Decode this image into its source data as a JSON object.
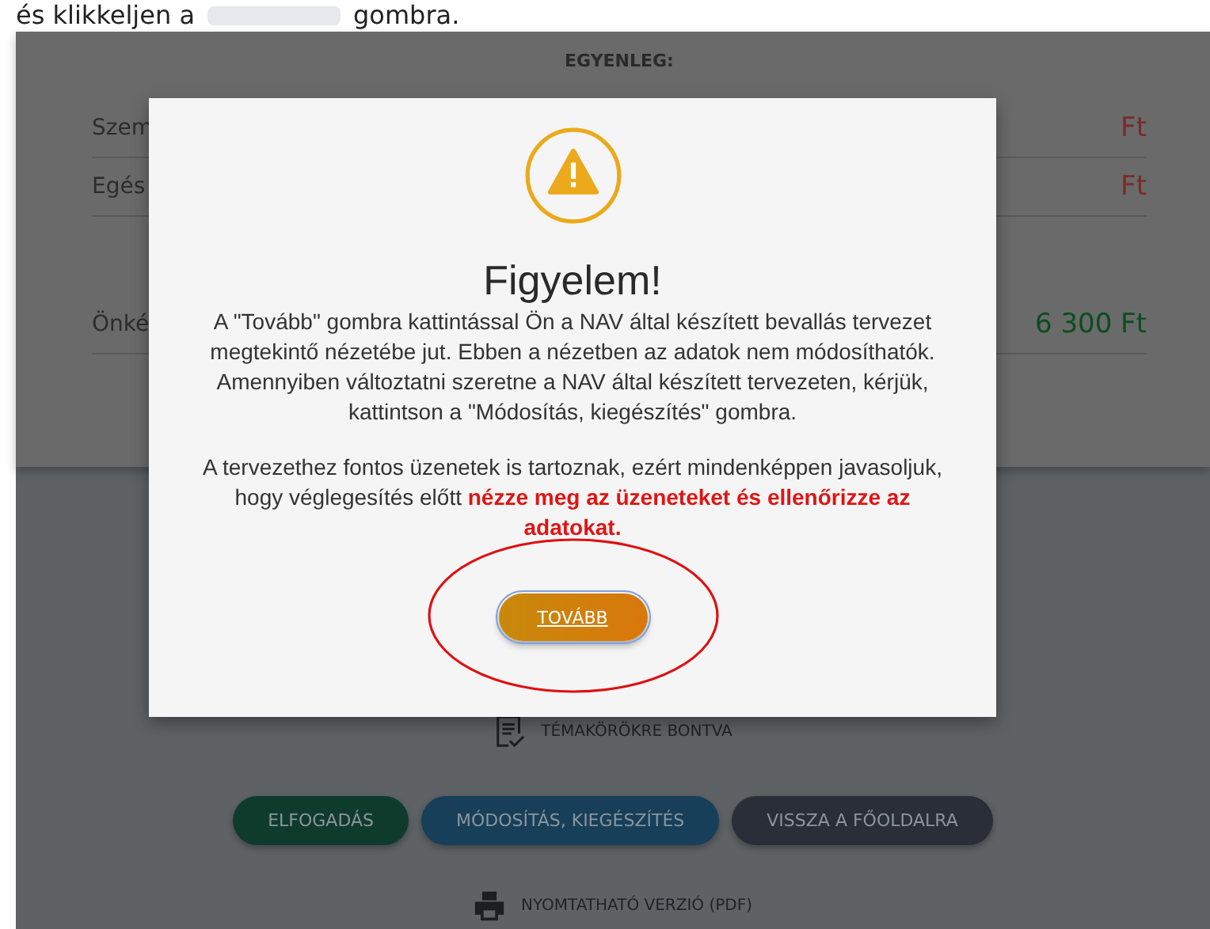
{
  "intro": {
    "before": "és klikkeljen a",
    "after": "gombra."
  },
  "balance": {
    "title": "EGYENLEG:",
    "rows": [
      {
        "label": "Szem",
        "amount": "Ft",
        "kind": "debit"
      },
      {
        "label": "Egés",
        "amount": "Ft",
        "kind": "debit"
      },
      {
        "label": "Önké",
        "amount": "6 300  Ft",
        "kind": "credit"
      }
    ]
  },
  "topics_link": "TÉMAKÖRÖKRE BONTVA",
  "actions": [
    {
      "label": "ELFOGADÁS",
      "kind": "accept"
    },
    {
      "label": "MÓDOSÍTÁS, KIEGÉSZÍTÉS",
      "kind": "modify"
    },
    {
      "label": "VISSZA A FŐOLDALRA",
      "kind": "back"
    }
  ],
  "print_link": "NYOMTATHATÓ VERZIÓ (PDF)",
  "modal": {
    "title": "Figyelem!",
    "paragraphs": [
      "A \"Tovább\" gombra kattintással Ön a NAV által készített bevallás tervezet megtekintő nézetébe jut. Ebben a nézetben az adatok nem módosíthatók. Amennyiben változtatni szeretne a NAV által készített tervezeten, kérjük, kattintson a \"Módosítás, kiegészítés\" gombra.",
      "A tervezethez fontos üzenetek is tartoznak, ezért mindenképpen javasoljuk, hogy véglegesítés előtt **nézze meg az üzeneteket és ellenőrizze az adatokat.**"
    ],
    "button": "TOVÁBB",
    "button_focused": true
  }
}
